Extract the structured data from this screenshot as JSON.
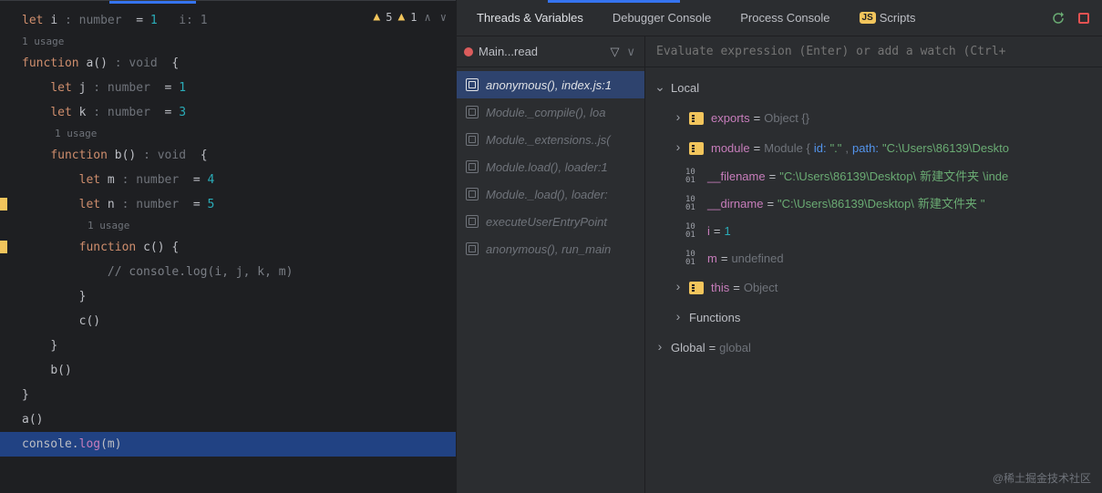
{
  "editor": {
    "warnings": {
      "count1": "5",
      "count2": "1"
    },
    "usages": {
      "one": "1 usage"
    },
    "code": {
      "l1_let": "let",
      "l1_i": "i",
      "l1_hint": " : number ",
      "l1_eq": " = ",
      "l1_val": "1",
      "l1_inlay": "   i: 1",
      "l3_fn": "function",
      "l3_name": " a",
      "l3_par": "()",
      "l3_hint": " : void ",
      "l3_brace": " {",
      "l4_let": "let",
      "l4_j": " j",
      "l4_hint": " : number ",
      "l4_eq": " = ",
      "l4_val": "1",
      "l5_let": "let",
      "l5_k": " k",
      "l5_hint": " : number ",
      "l5_eq": " = ",
      "l5_val": "3",
      "l7_fn": "function",
      "l7_name": " b",
      "l7_par": "()",
      "l7_hint": " : void ",
      "l7_brace": " {",
      "l8_let": "let",
      "l8_m": " m",
      "l8_hint": " : number ",
      "l8_eq": " = ",
      "l8_val": "4",
      "l9_let": "let",
      "l9_n": " n",
      "l9_hint": " : number ",
      "l9_eq": " = ",
      "l9_val": "5",
      "l11_fn": "function",
      "l11_name": " c",
      "l11_par": "() {",
      "l12_comment": "// console.log(i, j, k, m)",
      "l13_brace": "}",
      "l14_call": "c()",
      "l15_brace": "}",
      "l16_call": "b()",
      "l17_brace": "}",
      "l18_call": "a()",
      "l19_obj": "console",
      "l19_dot": ".",
      "l19_m": "log",
      "l19_arg": "(m)"
    }
  },
  "debug": {
    "tabs": {
      "t1": "Threads & Variables",
      "t2": "Debugger Console",
      "t3": "Process Console",
      "t4": "Scripts"
    },
    "thread": "Main...read",
    "frames": [
      {
        "label": "anonymous(), index.js:1"
      },
      {
        "label": "Module._compile(), loa"
      },
      {
        "label": "Module._extensions..js("
      },
      {
        "label": "Module.load(), loader:1"
      },
      {
        "label": "Module._load(), loader:"
      },
      {
        "label": "executeUserEntryPoint"
      },
      {
        "label": "anonymous(), run_main"
      }
    ],
    "eval_placeholder": "Evaluate expression (Enter) or add a watch (Ctrl+",
    "vars": {
      "local": "Local",
      "exports_n": "exports",
      "exports_v": "Object {}",
      "module_n": "module",
      "module_pre": "Module {",
      "module_id_k": "id:",
      "module_id_v": " \".\"",
      "module_c": ",",
      "module_path_k": "path:",
      "module_path_v": " \"C:\\Users\\86139\\Deskto",
      "filename_n": "__filename",
      "filename_v": "\"C:\\Users\\86139\\Desktop\\",
      "filename_cn": "新建文件夹",
      "filename_tail": "\\inde",
      "dirname_n": "__dirname",
      "dirname_v": "\"C:\\Users\\86139\\Desktop\\",
      "dirname_cn": "新建文件夹",
      "dirname_tail": "\"",
      "i_n": "i",
      "i_v": "1",
      "m_n": "m",
      "m_v": "undefined",
      "this_n": "this",
      "this_v": "Object",
      "functions": "Functions",
      "global_n": "Global",
      "global_v": "global"
    }
  },
  "watermark": "@稀土掘金技术社区"
}
